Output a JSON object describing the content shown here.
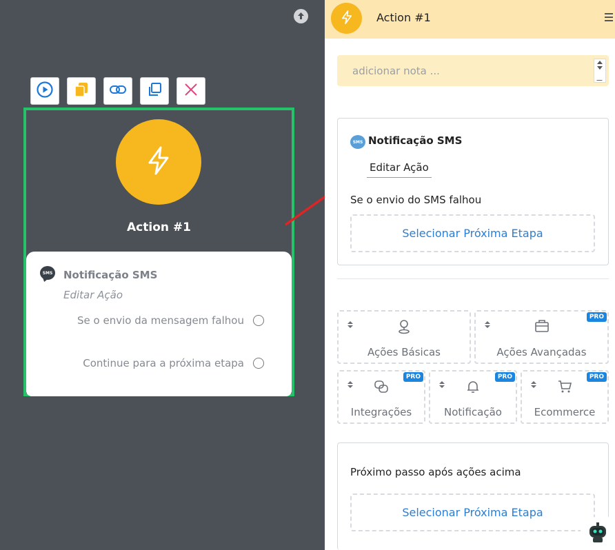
{
  "canvas": {
    "node": {
      "title": "Action #1",
      "card": {
        "title": "Notificação SMS",
        "subtitle": "Editar Ação",
        "outputs": [
          "Se o envio da mensagem falhou",
          "Continue para a próxima etapa"
        ]
      }
    },
    "toolbar": {
      "icons": [
        "play-icon",
        "copy-icon",
        "link-icon",
        "duplicate-icon",
        "close-icon"
      ]
    }
  },
  "panel": {
    "header": {
      "title": "Action #1",
      "icon": "lightning-icon"
    },
    "note": {
      "placeholder": "adicionar nota ..."
    },
    "sms_card": {
      "title": "Notificação SMS",
      "edit_label": "Editar Ação",
      "fail_text": "Se o envio do SMS falhou",
      "select_label": "Selecionar Próxima Etapa"
    },
    "categories": [
      {
        "label": "Ações Básicas",
        "pro": false,
        "icon": "user-pin-icon"
      },
      {
        "label": "Ações Avançadas",
        "pro": true,
        "icon": "toolbox-icon"
      },
      {
        "label": "Integrações",
        "pro": true,
        "icon": "integration-icon"
      },
      {
        "label": "Notificação",
        "pro": true,
        "icon": "bell-icon"
      },
      {
        "label": "Ecommerce",
        "pro": true,
        "icon": "cart-icon"
      }
    ],
    "pro_badge": "PRO",
    "next_card": {
      "text": "Próximo passo após ações acima",
      "select_label": "Selecionar Próxima Etapa"
    }
  },
  "sms_badge_text": "SMS",
  "colors": {
    "accent_yellow": "#f6b71f",
    "node_border": "#25c26a",
    "link_blue": "#2b7ed3",
    "pro_blue": "#1b86e0",
    "arrow_red": "#e02424",
    "header_bg": "#fde6b0"
  }
}
